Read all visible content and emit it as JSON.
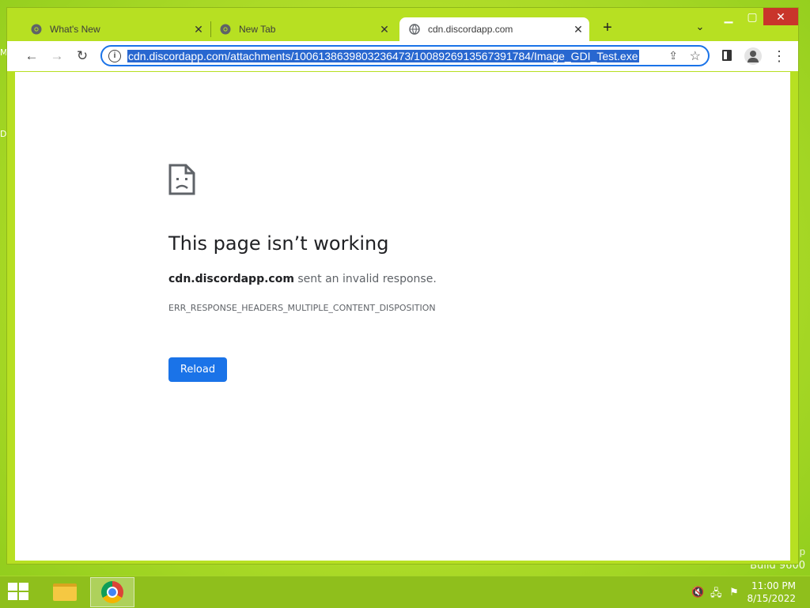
{
  "desktop": {
    "left_labels": [
      "M",
      "D"
    ],
    "build_partial": "p",
    "build_text": "Build 9600"
  },
  "tabs": [
    {
      "label": "What's New",
      "icon": "chrome-favicon",
      "active": false
    },
    {
      "label": "New Tab",
      "icon": "chrome-favicon",
      "active": false
    },
    {
      "label": "cdn.discordapp.com",
      "icon": "globe-favicon",
      "active": true
    }
  ],
  "toolbar": {
    "url": "cdn.discordapp.com/attachments/1006138639803236473/1008926913567391784/Image_GDI_Test.exe"
  },
  "error_page": {
    "title": "This page isn’t working",
    "host": "cdn.discordapp.com",
    "message": " sent an invalid response.",
    "code": "ERR_RESPONSE_HEADERS_MULTIPLE_CONTENT_DISPOSITION",
    "reload_label": "Reload"
  },
  "taskbar": {
    "time": "11:00 PM",
    "date": "8/15/2022"
  },
  "colors": {
    "accent": "#1a73e8",
    "desktop": "#b8e02c"
  }
}
